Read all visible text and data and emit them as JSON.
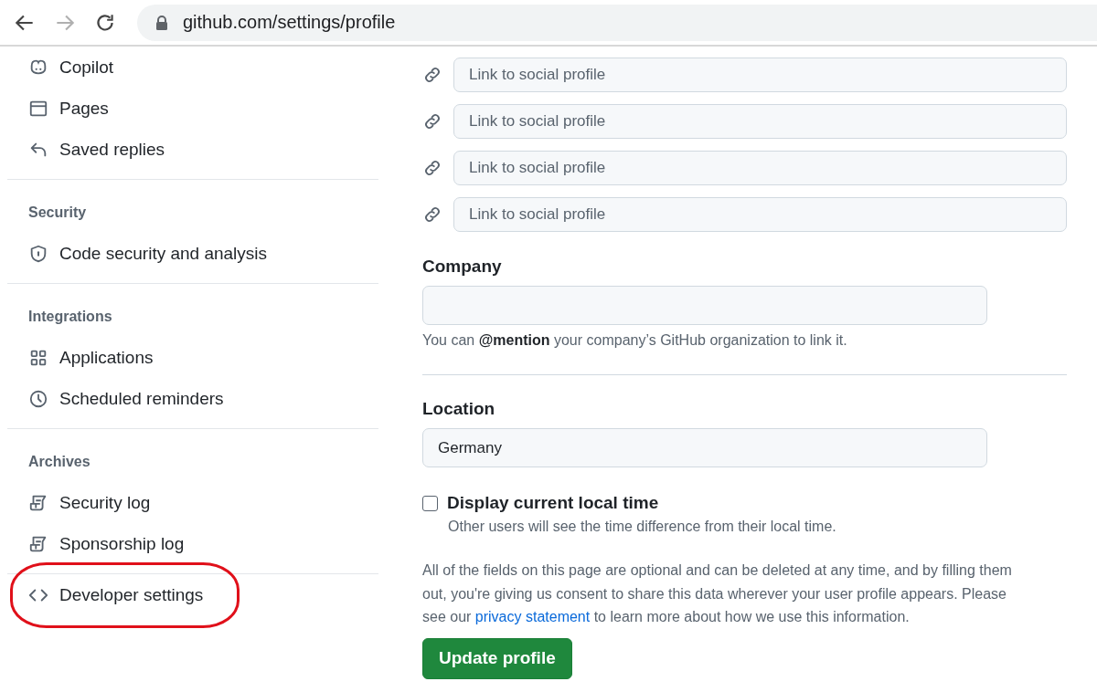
{
  "browser": {
    "nav_buttons": [
      {
        "kind": "back",
        "disabled": false
      },
      {
        "kind": "forward",
        "disabled": true
      },
      {
        "kind": "reload",
        "disabled": false
      }
    ],
    "url": "github.com/settings/profile"
  },
  "sidebar": {
    "groups": [
      {
        "items": [
          {
            "label": "Copilot",
            "kind": "copilot",
            "highlighted": false
          },
          {
            "label": "Pages",
            "kind": "browser",
            "highlighted": false
          },
          {
            "label": "Saved replies",
            "kind": "reply",
            "highlighted": false
          }
        ]
      },
      {
        "title": "Security",
        "items": [
          {
            "label": "Code security and analysis",
            "kind": "shield",
            "highlighted": false
          }
        ]
      },
      {
        "title": "Integrations",
        "items": [
          {
            "label": "Applications",
            "kind": "apps",
            "highlighted": false
          },
          {
            "label": "Scheduled reminders",
            "kind": "clock",
            "highlighted": false
          }
        ]
      },
      {
        "title": "Archives",
        "items": [
          {
            "label": "Security log",
            "kind": "log",
            "highlighted": false
          },
          {
            "label": "Sponsorship log",
            "kind": "log",
            "highlighted": false
          }
        ]
      },
      {
        "items": [
          {
            "label": "Developer settings",
            "kind": "code",
            "highlighted": true
          }
        ]
      }
    ]
  },
  "profile": {
    "social_links": [
      {
        "placeholder": "Link to social profile"
      },
      {
        "placeholder": "Link to social profile"
      },
      {
        "placeholder": "Link to social profile"
      },
      {
        "placeholder": "Link to social profile"
      }
    ],
    "company": {
      "label": "Company",
      "hint": "You can **@mention** your company’s GitHub organization to link it."
    },
    "location": {
      "label": "Location",
      "value": "Germany"
    },
    "local_time": {
      "label": "Display current local time",
      "checked": false,
      "hint": "Other users will see the time difference from their local time."
    },
    "notice": {
      "before": "All of the fields on this page are optional and can be deleted at any time, and by filling them out, you're giving us consent to share this data wherever your user profile appears. Please see our ",
      "link": "privacy statement",
      "after": " to learn more about how we use this information."
    },
    "submit": "Update profile"
  }
}
